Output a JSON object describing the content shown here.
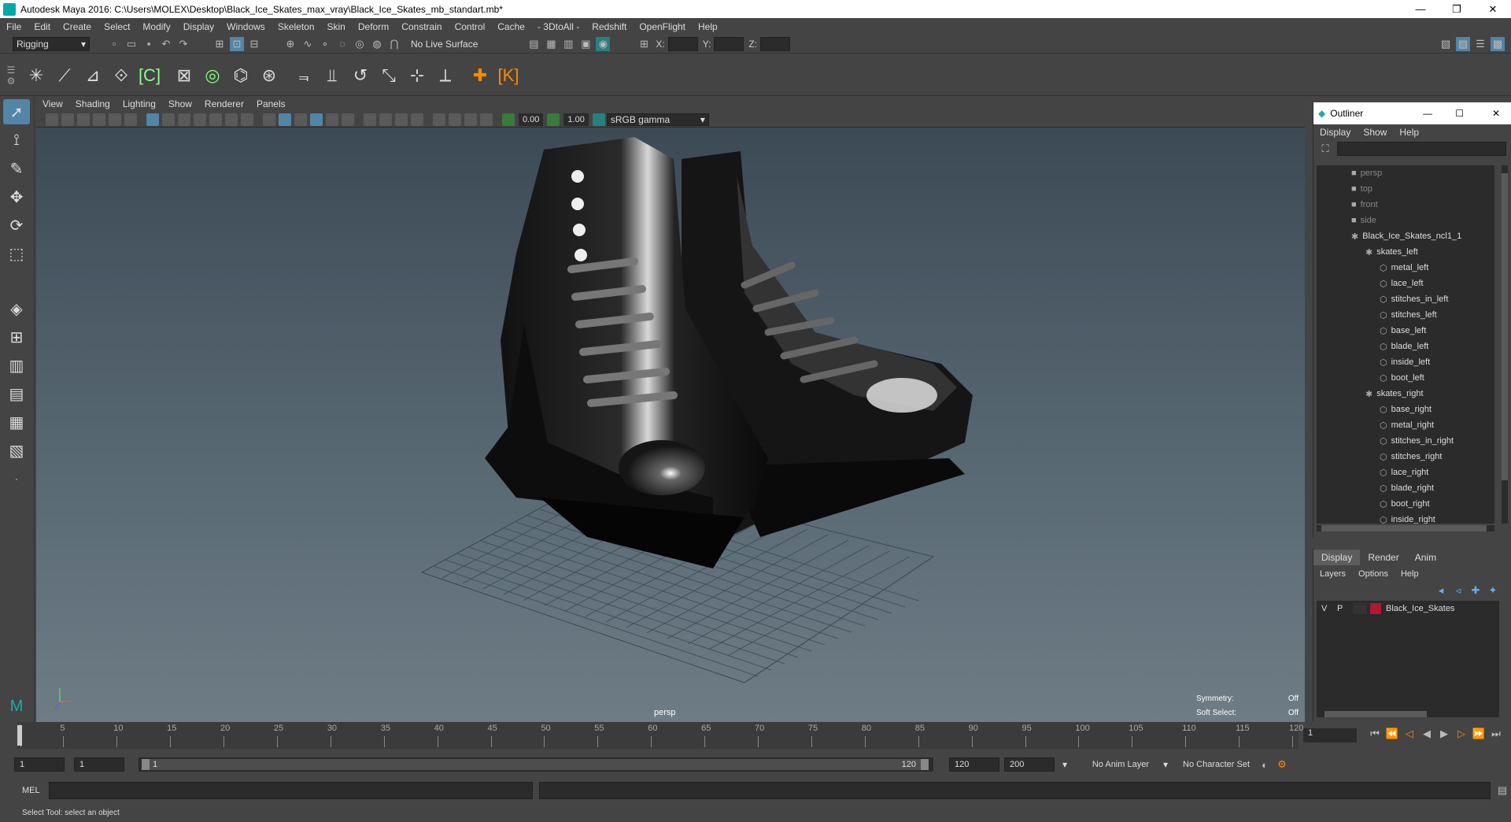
{
  "window": {
    "title": "Autodesk Maya 2016: C:\\Users\\MOLEX\\Desktop\\Black_Ice_Skates_max_vray\\Black_Ice_Skates_mb_standart.mb*"
  },
  "menu": [
    "File",
    "Edit",
    "Create",
    "Select",
    "Modify",
    "Display",
    "Windows",
    "Skeleton",
    "Skin",
    "Deform",
    "Constrain",
    "Control",
    "Cache",
    "- 3DtoAll -",
    "Redshift",
    "OpenFlight",
    "Help"
  ],
  "status": {
    "mode": "Rigging",
    "live_surface": "No Live Surface",
    "x_label": "X:",
    "y_label": "Y:",
    "z_label": "Z:"
  },
  "viewport": {
    "menu": [
      "View",
      "Shading",
      "Lighting",
      "Show",
      "Renderer",
      "Panels"
    ],
    "exposure": "0.00",
    "gamma": "1.00",
    "colorspace": "sRGB gamma",
    "camera_label": "persp",
    "symmetry_label": "Symmetry:",
    "symmetry_value": "Off",
    "soft_select_label": "Soft Select:",
    "soft_select_value": "Off"
  },
  "outliner": {
    "title": "Outliner",
    "menu": [
      "Display",
      "Show",
      "Help"
    ],
    "items": [
      {
        "label": "persp",
        "dim": true,
        "depth": 0
      },
      {
        "label": "top",
        "dim": true,
        "depth": 0
      },
      {
        "label": "front",
        "dim": true,
        "depth": 0
      },
      {
        "label": "side",
        "dim": true,
        "depth": 0
      },
      {
        "label": "Black_Ice_Skates_ncl1_1",
        "depth": 0
      },
      {
        "label": "skates_left",
        "depth": 1
      },
      {
        "label": "metal_left",
        "depth": 2
      },
      {
        "label": "lace_left",
        "depth": 2
      },
      {
        "label": "stitches_in_left",
        "depth": 2
      },
      {
        "label": "stitches_left",
        "depth": 2
      },
      {
        "label": "base_left",
        "depth": 2
      },
      {
        "label": "blade_left",
        "depth": 2
      },
      {
        "label": "inside_left",
        "depth": 2
      },
      {
        "label": "boot_left",
        "depth": 2
      },
      {
        "label": "skates_right",
        "depth": 1
      },
      {
        "label": "base_right",
        "depth": 2
      },
      {
        "label": "metal_right",
        "depth": 2
      },
      {
        "label": "stitches_in_right",
        "depth": 2
      },
      {
        "label": "stitches_right",
        "depth": 2
      },
      {
        "label": "lace_right",
        "depth": 2
      },
      {
        "label": "blade_right",
        "depth": 2
      },
      {
        "label": "boot_right",
        "depth": 2
      },
      {
        "label": "inside_right",
        "depth": 2
      }
    ]
  },
  "layers": {
    "tabs": [
      "Display",
      "Render",
      "Anim"
    ],
    "menu": [
      "Layers",
      "Options",
      "Help"
    ],
    "layer": {
      "v": "V",
      "p": "P",
      "name": "Black_Ice_Skates",
      "color": "#b01830"
    }
  },
  "timeline": {
    "ticks": [
      "1",
      "5",
      "10",
      "15",
      "20",
      "25",
      "30",
      "35",
      "40",
      "45",
      "50",
      "55",
      "60",
      "65",
      "70",
      "75",
      "80",
      "85",
      "90",
      "95",
      "100",
      "105",
      "110",
      "115",
      "120"
    ],
    "current_frame": "1"
  },
  "range": {
    "start": "1",
    "start2": "1",
    "slider_start": "1",
    "slider_end": "120",
    "end": "120",
    "end2": "200",
    "anim_layer": "No Anim Layer",
    "char_set": "No Character Set"
  },
  "cmd": {
    "label": "MEL"
  },
  "help": {
    "text": "Select Tool: select an object"
  }
}
